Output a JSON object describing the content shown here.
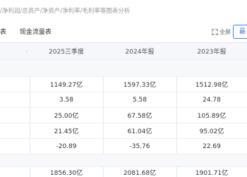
{
  "breadcrumb_text": "/净利润/总资产/净资产/净利率/毛利率等图表分析",
  "tabs": [
    {
      "label": "表"
    },
    {
      "label": "现金流量表"
    }
  ],
  "toolbar": {
    "fullscreen_label": "全屏",
    "latest_label": "最"
  },
  "table": {
    "columns": [
      "2025三季度",
      "2024年报",
      "2023年报"
    ],
    "rows": [
      {
        "values": [
          "",
          "",
          ""
        ]
      },
      {
        "values": [
          "1149.27亿",
          "1597.33亿",
          "1512.98亿"
        ]
      },
      {
        "values": [
          "3.58",
          "5.58",
          "24.78"
        ]
      },
      {
        "values": [
          "25.00亿",
          "67.58亿",
          "105.89亿"
        ]
      },
      {
        "values": [
          "21.45亿",
          "61.04亿",
          "95.02亿"
        ]
      },
      {
        "values": [
          "-20.89",
          "-35.76",
          "22.69"
        ]
      },
      {
        "values": [
          "",
          "",
          ""
        ]
      },
      {
        "values": [
          "1856.30亿",
          "2081.68亿",
          "1901.71亿"
        ]
      }
    ]
  }
}
